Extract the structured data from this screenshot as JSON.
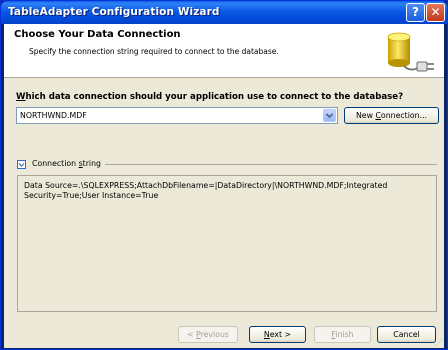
{
  "window": {
    "title": "TableAdapter Configuration Wizard",
    "help_glyph": "?",
    "close_glyph": "✕"
  },
  "header": {
    "title": "Choose Your Data Connection",
    "description": "Specify the connection string required to connect to the database."
  },
  "question": {
    "label_prefix": "W",
    "label_rest": "hich data connection should your application use to connect to the database?"
  },
  "connection_combo": {
    "value": "NORTHWND.MDF"
  },
  "new_connection_button": {
    "label_prefix": "New ",
    "label_mnemonic": "C",
    "label_rest": "onnection..."
  },
  "connection_string_group": {
    "label_prefix": "Connection ",
    "label_mnemonic": "s",
    "label_rest": "tring",
    "value": "Data Source=.\\SQLEXPRESS;AttachDbFilename=|DataDirectory|\\NORTHWND.MDF;Integrated Security=True;User Instance=True"
  },
  "footer": {
    "previous_prefix": "< ",
    "previous_mnemonic": "P",
    "previous_rest": "revious",
    "next_mnemonic": "N",
    "next_rest": "ext >",
    "finish_mnemonic": "F",
    "finish_rest": "inish",
    "cancel_label": "Cancel"
  },
  "colors": {
    "titlebar": "#0a5ae6",
    "client_bg": "#ece9d8",
    "button_border": "#003c74",
    "disabled_text": "#a29f90"
  },
  "icons": {
    "database": "database-plug-icon",
    "help": "help-icon",
    "close": "close-icon",
    "collapse": "collapse-icon",
    "dropdown": "chevron-down-icon"
  }
}
